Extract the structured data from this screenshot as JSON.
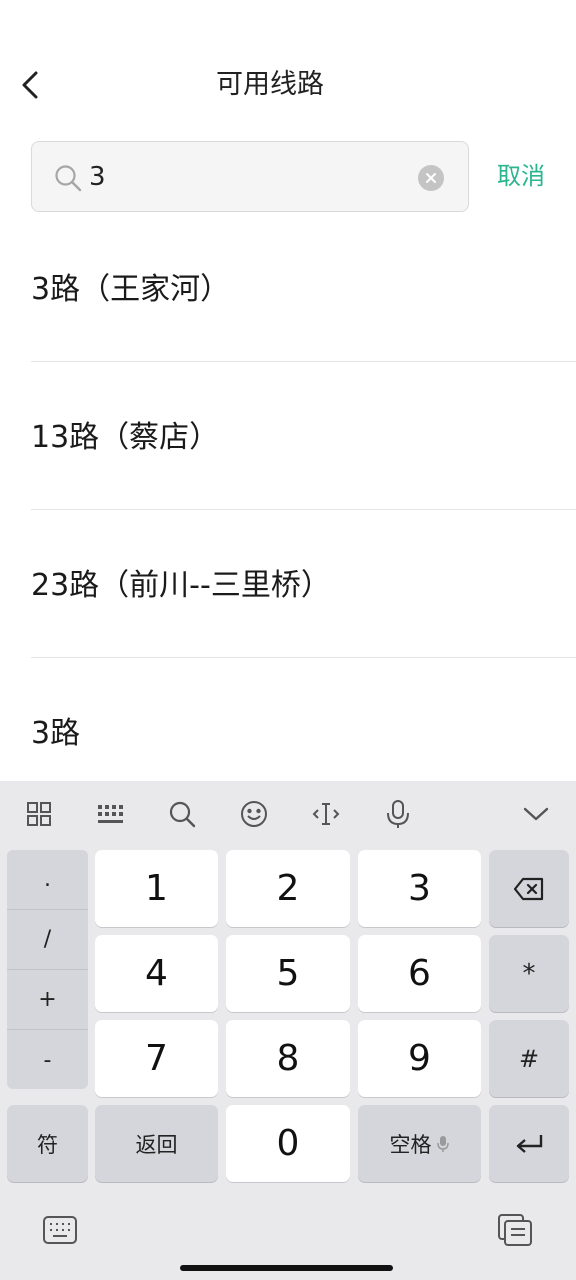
{
  "header": {
    "title": "可用线路",
    "back_icon": "chevron-left-icon"
  },
  "search": {
    "value": "3",
    "cancel_label": "取消",
    "accent_color": "#2bb58f"
  },
  "results": [
    {
      "label": "3路（王家河）"
    },
    {
      "label": "13路（蔡店）"
    },
    {
      "label": "23路（前川--三里桥）"
    },
    {
      "label": "3路"
    }
  ],
  "keyboard": {
    "toolbar_icons": [
      "grid-icon",
      "keyboard-layout-icon",
      "search-icon",
      "emoji-icon",
      "cursor-icon",
      "microphone-icon",
      "chevron-down-icon"
    ],
    "symbols": [
      ".",
      "/",
      "+",
      "-"
    ],
    "digits": [
      "1",
      "2",
      "3",
      "4",
      "5",
      "6",
      "7",
      "8",
      "9",
      "0"
    ],
    "star": "*",
    "hash": "#",
    "symbol_label": "符",
    "back_label": "返回",
    "space_label": "空格"
  }
}
